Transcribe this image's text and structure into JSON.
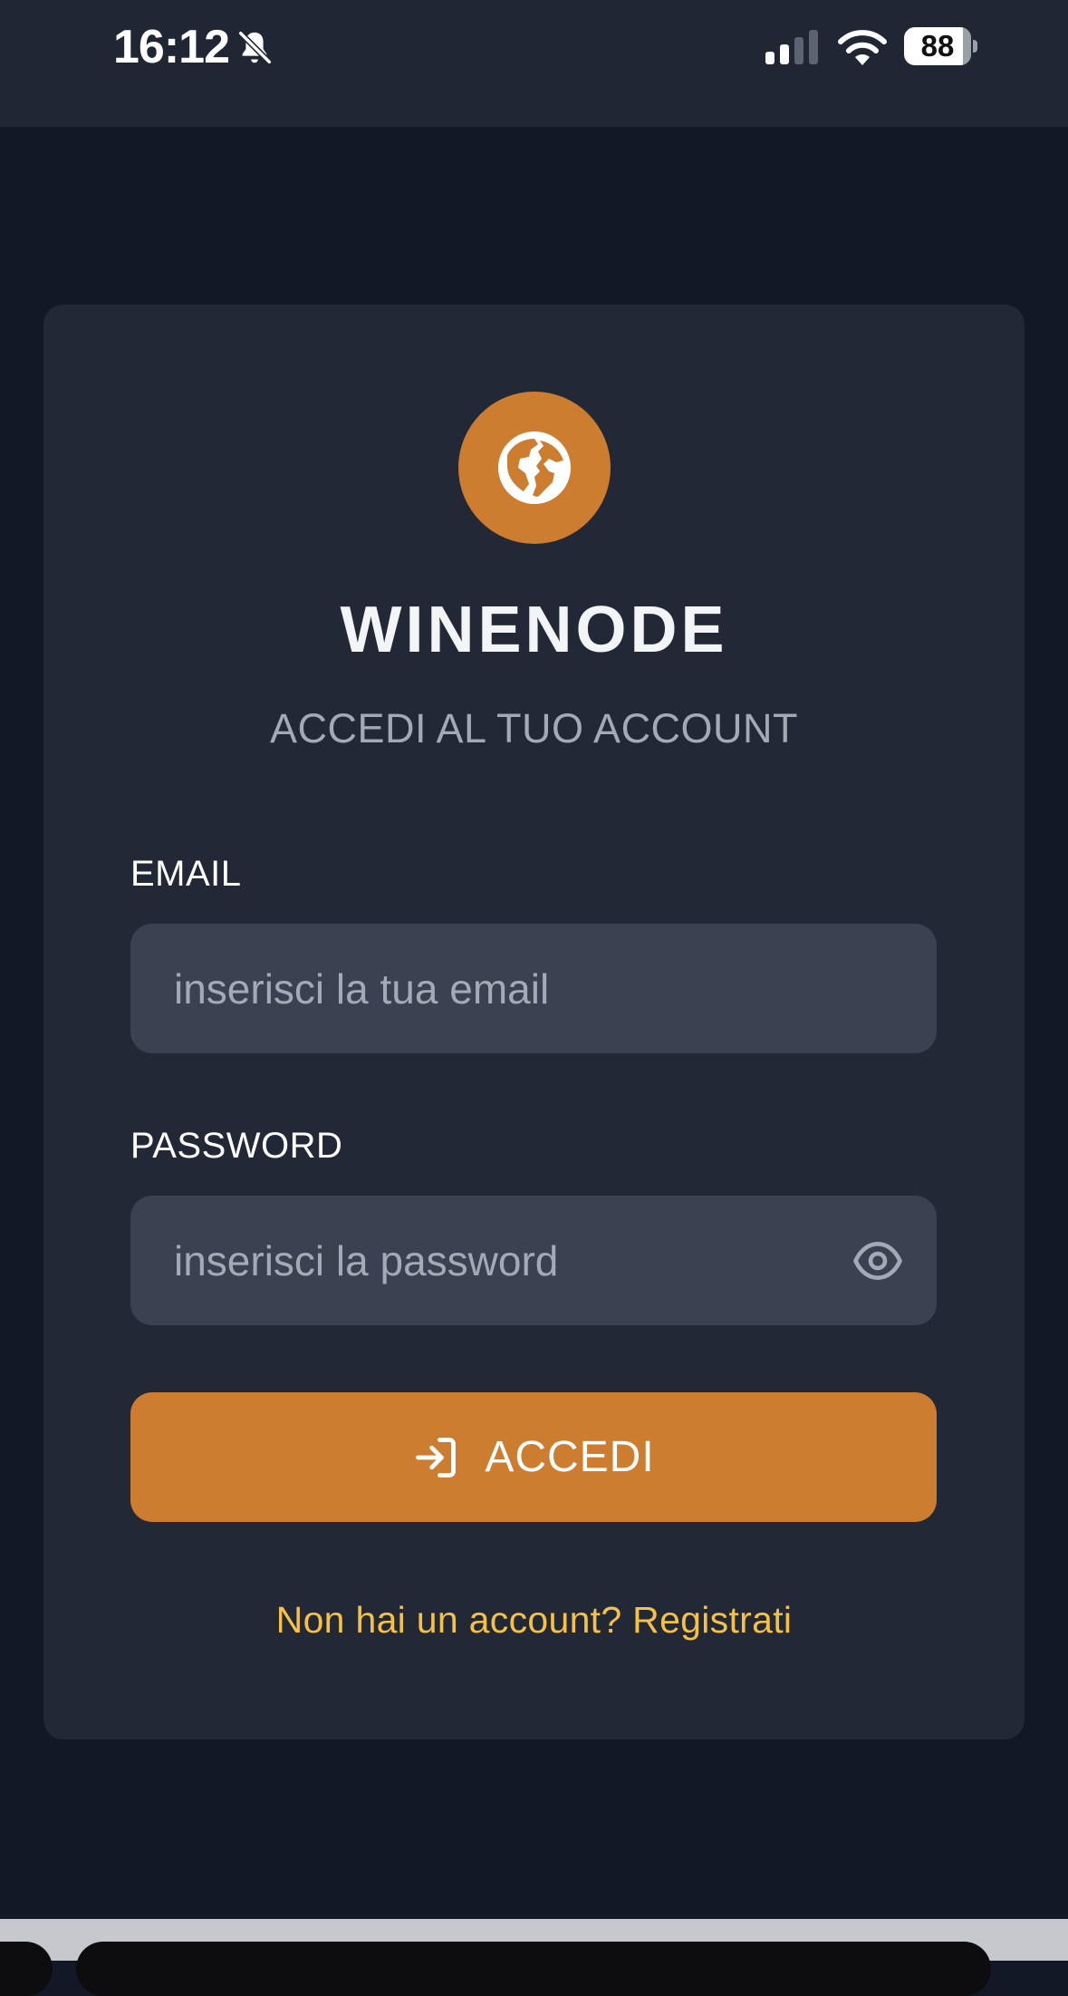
{
  "status_bar": {
    "time": "16:12",
    "battery": "88",
    "battery_level": 0.88,
    "icons": [
      "bell-muted-icon",
      "cellular-signal-icon",
      "wifi-icon",
      "battery-icon"
    ]
  },
  "brand": {
    "title": "WINENODE",
    "subtitle": "ACCEDI AL TUO ACCOUNT",
    "logo_icon": "globe-icon",
    "accent_color": "#cd7d30"
  },
  "form": {
    "email_label": "EMAIL",
    "email_placeholder": "inserisci la tua email",
    "email_value": "",
    "password_label": "PASSWORD",
    "password_placeholder": "inserisci la password",
    "password_value": "",
    "password_toggle_icon": "eye-icon",
    "submit_icon": "login-arrow-icon",
    "submit_label": "ACCEDI",
    "register_link": "Non hai un account? Registrati",
    "link_color": "#f4c046"
  },
  "colors": {
    "background": "#121826",
    "card": "#222835",
    "input": "#3b4150"
  }
}
